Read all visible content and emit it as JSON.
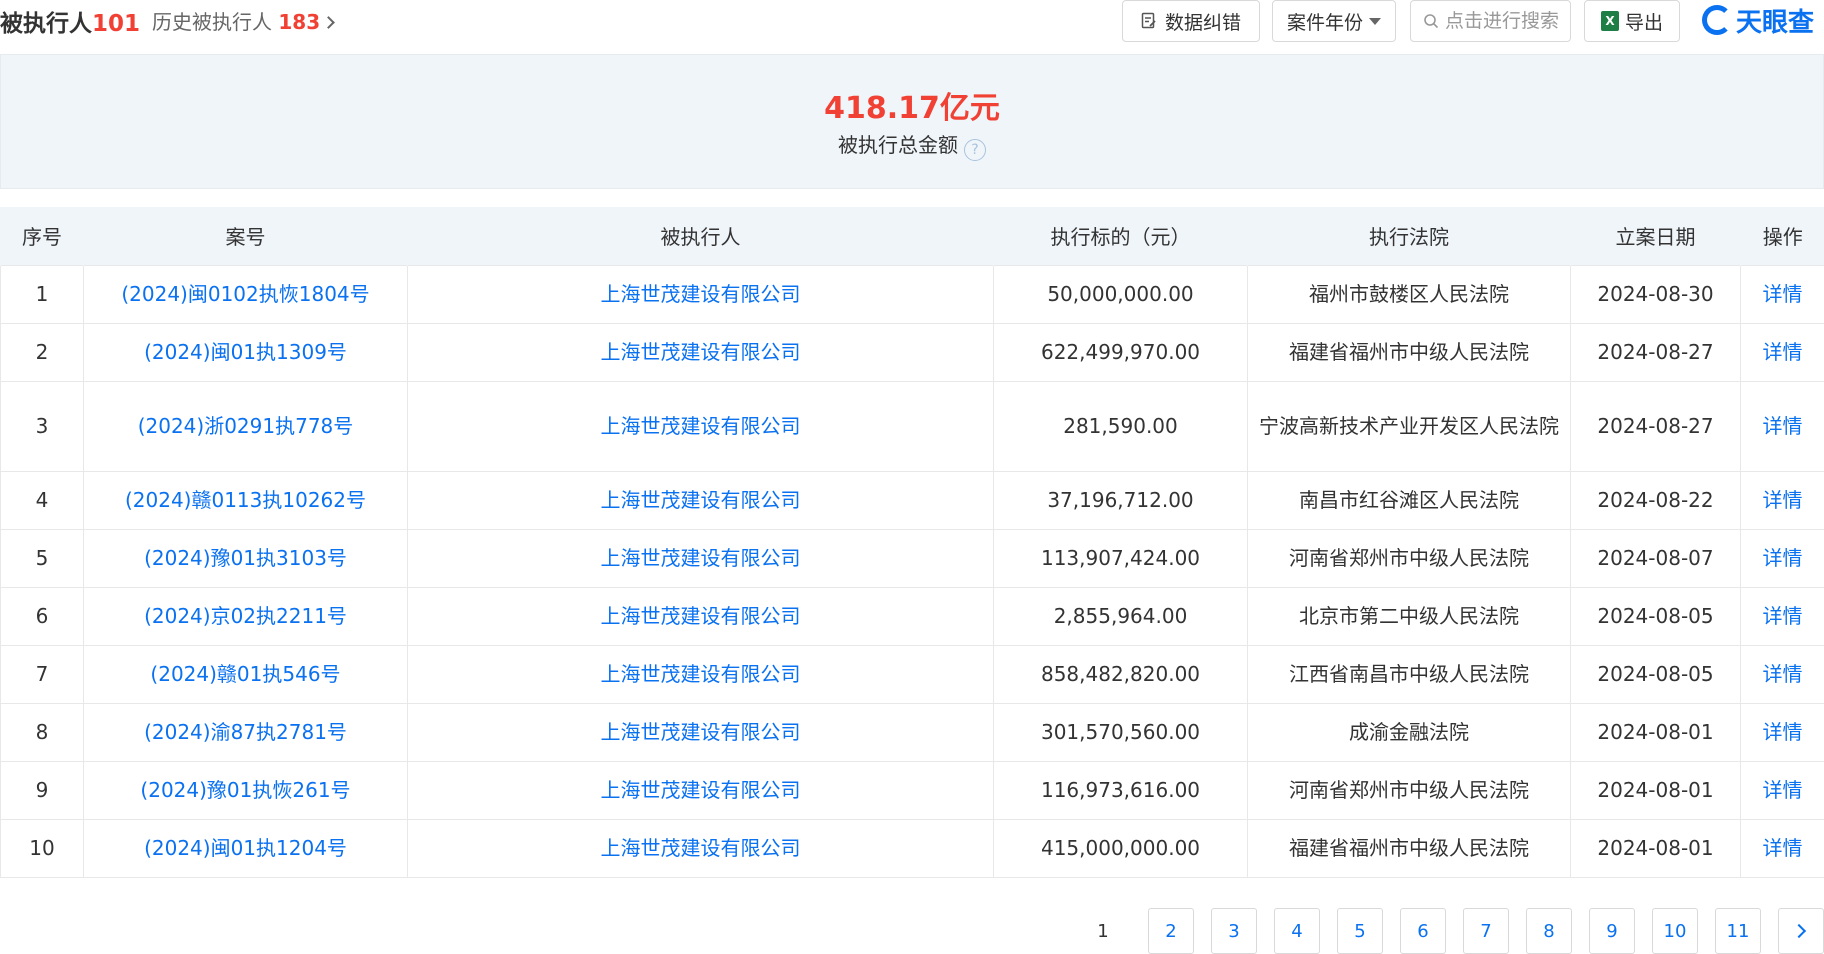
{
  "header": {
    "title": "被执行人",
    "title_count": "101",
    "history_label": "历史被执行人",
    "history_count": "183",
    "correct_label": "数据纠错",
    "year_label": "案件年份",
    "search_placeholder": "点击进行搜索",
    "export_label": "导出",
    "logo_text": "天眼查"
  },
  "summary": {
    "amount": "418.17亿元",
    "label": "被执行总金额",
    "help": "?"
  },
  "table": {
    "columns": [
      "序号",
      "案号",
      "被执行人",
      "执行标的（元）",
      "执行法院",
      "立案日期",
      "操作"
    ],
    "rows": [
      {
        "no": "1",
        "case": "(2024)闽0102执恢1804号",
        "party": "上海世茂建设有限公司",
        "amount": "50,000,000.00",
        "court": "福州市鼓楼区人民法院",
        "date": "2024-08-30",
        "action": "详情"
      },
      {
        "no": "2",
        "case": "(2024)闽01执1309号",
        "party": "上海世茂建设有限公司",
        "amount": "622,499,970.00",
        "court": "福建省福州市中级人民法院",
        "date": "2024-08-27",
        "action": "详情"
      },
      {
        "no": "3",
        "case": "(2024)浙0291执778号",
        "party": "上海世茂建设有限公司",
        "amount": "281,590.00",
        "court": "宁波高新技术产业开发区人民法院",
        "date": "2024-08-27",
        "action": "详情"
      },
      {
        "no": "4",
        "case": "(2024)赣0113执10262号",
        "party": "上海世茂建设有限公司",
        "amount": "37,196,712.00",
        "court": "南昌市红谷滩区人民法院",
        "date": "2024-08-22",
        "action": "详情"
      },
      {
        "no": "5",
        "case": "(2024)豫01执3103号",
        "party": "上海世茂建设有限公司",
        "amount": "113,907,424.00",
        "court": "河南省郑州市中级人民法院",
        "date": "2024-08-07",
        "action": "详情"
      },
      {
        "no": "6",
        "case": "(2024)京02执2211号",
        "party": "上海世茂建设有限公司",
        "amount": "2,855,964.00",
        "court": "北京市第二中级人民法院",
        "date": "2024-08-05",
        "action": "详情"
      },
      {
        "no": "7",
        "case": "(2024)赣01执546号",
        "party": "上海世茂建设有限公司",
        "amount": "858,482,820.00",
        "court": "江西省南昌市中级人民法院",
        "date": "2024-08-05",
        "action": "详情"
      },
      {
        "no": "8",
        "case": "(2024)渝87执2781号",
        "party": "上海世茂建设有限公司",
        "amount": "301,570,560.00",
        "court": "成渝金融法院",
        "date": "2024-08-01",
        "action": "详情"
      },
      {
        "no": "9",
        "case": "(2024)豫01执恢261号",
        "party": "上海世茂建设有限公司",
        "amount": "116,973,616.00",
        "court": "河南省郑州市中级人民法院",
        "date": "2024-08-01",
        "action": "详情"
      },
      {
        "no": "10",
        "case": "(2024)闽01执1204号",
        "party": "上海世茂建设有限公司",
        "amount": "415,000,000.00",
        "court": "福建省福州市中级人民法院",
        "date": "2024-08-01",
        "action": "详情"
      }
    ]
  },
  "pagination": {
    "pages": [
      "1",
      "2",
      "3",
      "4",
      "5",
      "6",
      "7",
      "8",
      "9",
      "10",
      "11"
    ],
    "current": "1"
  },
  "colors": {
    "accent": "#0a71f0",
    "highlight": "#f04134",
    "header_bg": "#f0f5fa"
  },
  "icons": {
    "correct": "edit-doc-icon",
    "search": "search-icon",
    "export": "excel-icon",
    "help": "question-circle-icon",
    "next": "chevron-right-icon"
  }
}
